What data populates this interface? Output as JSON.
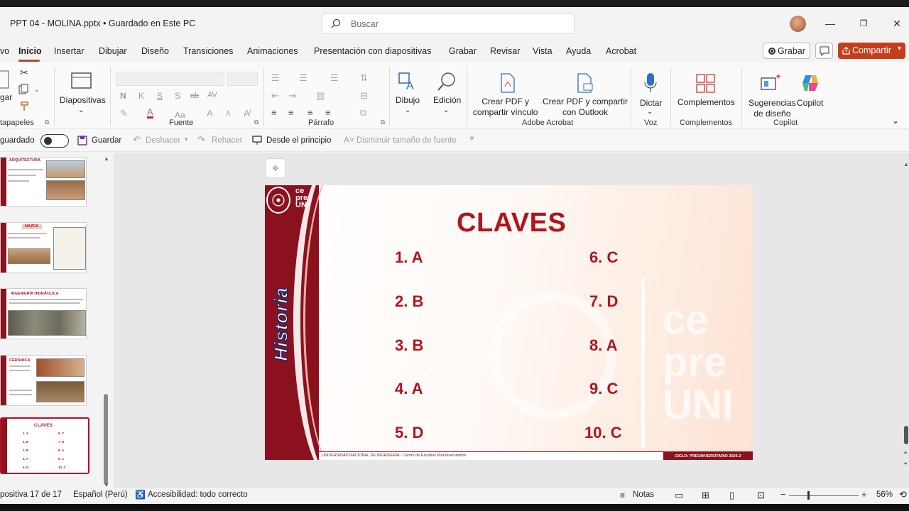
{
  "titlebar": {
    "doc_title": "PPT 04 - MOLINA.pptx • Guardado en Este PC",
    "search_placeholder": "Buscar"
  },
  "tabs": [
    "vo",
    "Inicio",
    "Insertar",
    "Dibujar",
    "Diseño",
    "Transiciones",
    "Animaciones",
    "Presentación con diapositivas",
    "Grabar",
    "Revisar",
    "Vista",
    "Ayuda",
    "Acrobat"
  ],
  "actions": {
    "grabar": "Grabar",
    "compartir": "Compartir"
  },
  "ribbon": {
    "clipboard_paste": "gar",
    "clipboard_group": "tapapeles",
    "slides_button": "Diapositivas",
    "font_group": "Fuente",
    "font_n": "N",
    "font_k": "K",
    "font_s": "S",
    "font_s2": "S",
    "font_abc": "ab",
    "font_av": "AV",
    "font_aa": "Aa",
    "paragraph_group": "Párrafo",
    "drawing_button": "Dibujo",
    "editing_button": "Edición",
    "acrobat_create": "Crear PDF y\ncompartir vínculo",
    "acrobat_outlook": "Crear PDF y compartir\ncon Outlook",
    "acrobat_group": "Adobe Acrobat",
    "dictate_button": "Dictar",
    "voice_group": "Voz",
    "addins_button": "Complementos",
    "addins_group": "Complementos",
    "designer_button": "Sugerencias\nde diseño",
    "copilot_button": "Copilot",
    "copilot_group": "Copilot"
  },
  "qat": {
    "autosave": "guardado",
    "save": "Guardar",
    "undo": "Deshacer",
    "redo": "Rehacer",
    "from_start": "Desde el principio",
    "decrease_font": "Disminuir tamaño de fuente"
  },
  "thumbnails": [
    {
      "title": "ARQUITECTURA"
    },
    {
      "title": "NAZCA"
    },
    {
      "title": "INGENIERÍA HIDRÁULICA"
    },
    {
      "title": "CERÁMICA"
    },
    {
      "title": "CLAVES",
      "rows": [
        [
          "1. A",
          "6. C"
        ],
        [
          "2. B",
          "7. D"
        ],
        [
          "3. B",
          "8. A"
        ],
        [
          "4. A",
          "9. C"
        ],
        [
          "5. D",
          "10. C"
        ]
      ]
    }
  ],
  "slide": {
    "title": "CLAVES",
    "band_text": "Historia",
    "logo_text": "ce\npre\nUNI",
    "watermark": "ce\npre\nUNI",
    "answers_left": [
      "1. A",
      "2. B",
      "3. B",
      "4. A",
      "5. D"
    ],
    "answers_right": [
      "6. C",
      "7. D",
      "8. A",
      "9. C",
      "10. C"
    ],
    "footer_left": "UNIVERSIDAD NACIONAL DE INGENIERÍA - Centro de Estudios Preuniversitarios",
    "footer_right": "CICLO: PREUNIVERSITARIO 2026-2",
    "colors": {
      "accent": "#b3141c",
      "band": "#8b111e"
    }
  },
  "status": {
    "slide_counter": "positiva 17 de 17",
    "language": "Español (Perú)",
    "accessibility": "Accesibilidad: todo correcto",
    "notes": "Notas",
    "zoom": "56%"
  }
}
